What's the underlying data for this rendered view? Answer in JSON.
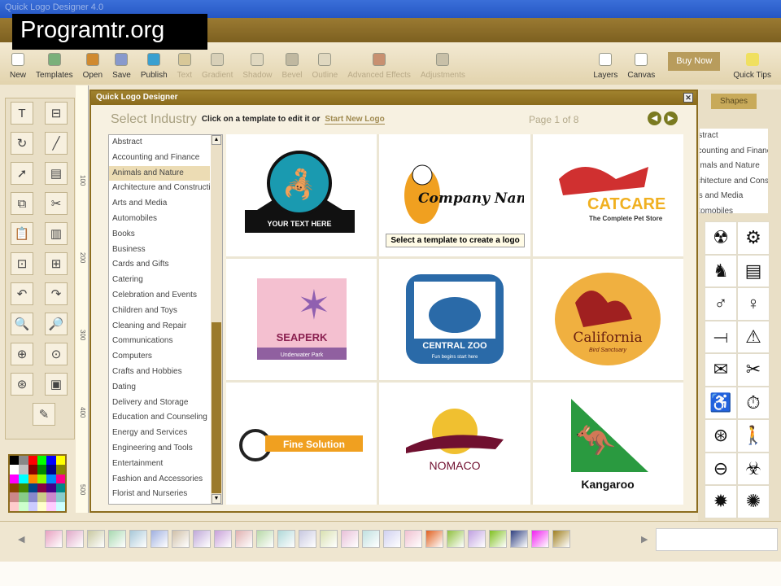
{
  "window": {
    "title": "Quick Logo Designer 4.0"
  },
  "watermark": "Programtr.org",
  "toolbar": [
    {
      "label": "New",
      "color": "#fff",
      "enabled": true
    },
    {
      "label": "Templates",
      "color": "#7ab07a",
      "enabled": true
    },
    {
      "label": "Open",
      "color": "#d08a30",
      "enabled": true
    },
    {
      "label": "Save",
      "color": "#8899cc",
      "enabled": true
    },
    {
      "label": "Publish",
      "color": "#3aa0d0",
      "enabled": true
    },
    {
      "label": "Text",
      "color": "#d8c898",
      "enabled": false
    },
    {
      "label": "Gradient",
      "color": "#d8d0b8",
      "enabled": false
    },
    {
      "label": "Shadow",
      "color": "#e0d8c0",
      "enabled": false
    },
    {
      "label": "Bevel",
      "color": "#c0b8a0",
      "enabled": false
    },
    {
      "label": "Outline",
      "color": "#e0d8c0",
      "enabled": false
    },
    {
      "label": "Advanced Effects",
      "color": "#c89070",
      "enabled": false
    },
    {
      "label": "Adjustments",
      "color": "#c8c0a8",
      "enabled": false
    },
    {
      "label": "Layers",
      "color": "#fff",
      "enabled": true
    },
    {
      "label": "Canvas",
      "color": "#fff",
      "enabled": true
    }
  ],
  "buy_now": "Buy Now",
  "quick_tips": "Quick Tips",
  "left_tools": [
    "T",
    "⊟",
    "↻",
    "╱",
    "➚",
    "▤",
    "⧉",
    "✂",
    "📋",
    "▥",
    "⊡",
    "⊞",
    "↶",
    "↷",
    "🔍",
    "🔎",
    "⊕",
    "⊙",
    "⊛",
    "▣",
    "✎"
  ],
  "ruler_marks": [
    "100",
    "200",
    "300",
    "400",
    "500"
  ],
  "dialog": {
    "title": "Quick Logo Designer",
    "select_industry": "Select Industry",
    "hint": "Click on a template to edit it or",
    "start_new": "Start New Logo",
    "page_info": "Page 1 of 8",
    "tooltip": "Select a template to create a logo",
    "industries": [
      "Abstract",
      "Accounting and Finance",
      "Animals and Nature",
      "Architecture and Construction",
      "Arts and Media",
      "Automobiles",
      "Books",
      "Business",
      "Cards and Gifts",
      "Catering",
      "Celebration and Events",
      "Children and Toys",
      "Cleaning and Repair",
      "Communications",
      "Computers",
      "Crafts and Hobbies",
      "Dating",
      "Delivery and Storage",
      "Education and Counseling",
      "Energy and Services",
      "Engineering and Tools",
      "Entertainment",
      "Fashion and Accessories",
      "Florist and Nurseries"
    ],
    "selected_industry": "Animals and Nature",
    "templates": [
      {
        "name": "YOUR TEXT HERE",
        "sub": ""
      },
      {
        "name": "Company Name",
        "sub": ""
      },
      {
        "name": "CATCARE",
        "sub": "The Complete Pet Store"
      },
      {
        "name": "SEAPERK",
        "sub": "Underwater Park"
      },
      {
        "name": "CENTRAL ZOO",
        "sub": "Fun begins start here"
      },
      {
        "name": "California",
        "sub": "Bird Sanctuary"
      },
      {
        "name": "Fine Solution",
        "sub": ""
      },
      {
        "name": "NOMACO",
        "sub": ""
      },
      {
        "name": "Kangaroo",
        "sub": ""
      }
    ]
  },
  "right_panel": {
    "tab": "Shapes",
    "list": [
      "Abstract",
      "Accounting and Finance",
      "Animals and Nature",
      "Architecture and Construction",
      "Arts and Media",
      "Automobiles"
    ],
    "icons": [
      "☢",
      "⚙",
      "♞",
      "▤",
      "♂",
      "♀",
      "⟞",
      "⚠",
      "✉",
      "✂",
      "♿",
      "⏱",
      "⊛",
      "🚶",
      "⊖",
      "☣",
      "✹",
      "✺"
    ]
  },
  "swatches": [
    "#e8a0c0",
    "#e0a8c8",
    "#c8c8a0",
    "#a8d8b0",
    "#a8c8d8",
    "#a0b0e0",
    "#d0c0a8",
    "#c0a8d8",
    "#c8a0d8",
    "#e0b0b0",
    "#b8d8a8",
    "#b0d8d8",
    "#c8c8e0",
    "#d8e0b0",
    "#e8c0d8",
    "#c0e0e0",
    "#d0d0f0",
    "#f0c0d0",
    "#e06020",
    "#90c040",
    "#c0a0e0",
    "#80c020",
    "#304080",
    "#f020f0",
    "#a08020"
  ]
}
